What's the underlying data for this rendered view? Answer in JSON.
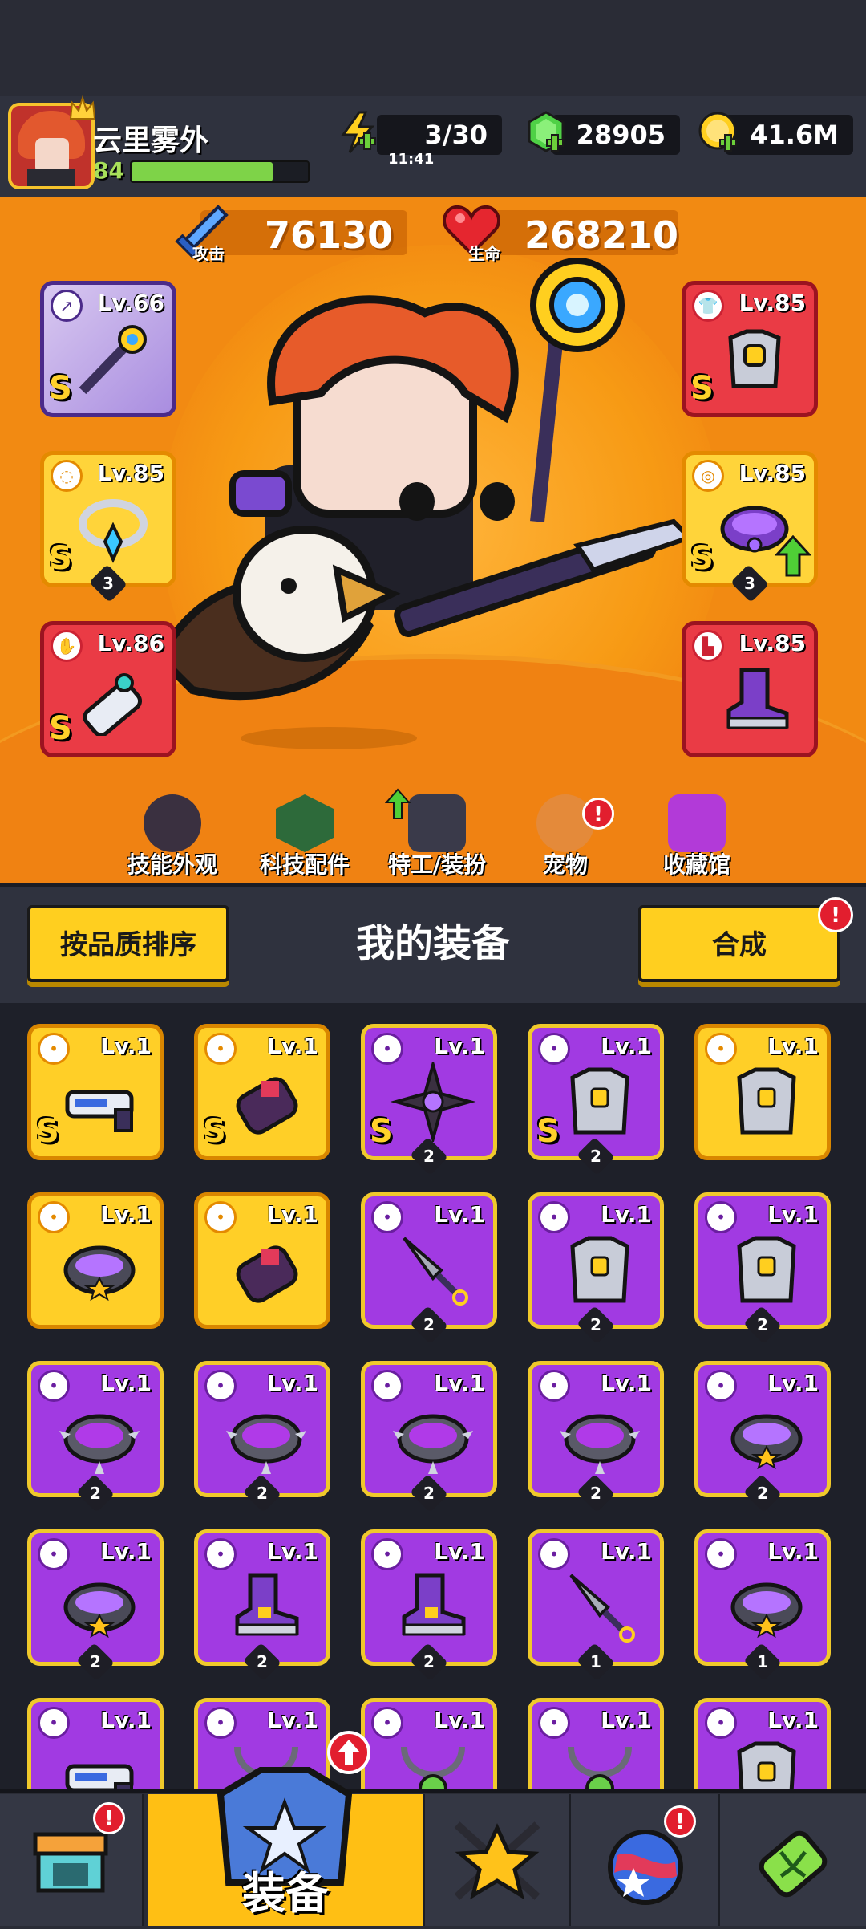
{
  "player": {
    "name": "云里雾外",
    "level": "84",
    "xp_fraction": 0.8
  },
  "resources": {
    "energy": {
      "value": "3/30",
      "timer": "11:41"
    },
    "gems": {
      "value": "28905"
    },
    "coins": {
      "value": "41.6M"
    }
  },
  "stats": {
    "attack": {
      "label": "攻击",
      "value": "76130"
    },
    "health": {
      "label": "生命",
      "value": "268210"
    }
  },
  "equipped": {
    "weapon": {
      "level": "Lv.66",
      "grade": "S"
    },
    "necklace": {
      "level": "Lv.85",
      "grade": "S",
      "count": "3"
    },
    "glove": {
      "level": "Lv.86",
      "grade": "S"
    },
    "armor": {
      "level": "Lv.85",
      "grade": "S"
    },
    "belt": {
      "level": "Lv.85",
      "grade": "S",
      "count": "3"
    },
    "boots": {
      "level": "Lv.85"
    }
  },
  "hero_nav": [
    {
      "label": "技能外观"
    },
    {
      "label": "科技配件"
    },
    {
      "label": "特工/装扮"
    },
    {
      "label": "宠物"
    },
    {
      "label": "收藏馆"
    }
  ],
  "equipment_panel": {
    "title": "我的装备",
    "sort_label": "按品质排序",
    "merge_label": "合成"
  },
  "inventory": [
    {
      "level": "Lv.1",
      "grade": "S",
      "quality": "gold",
      "icon": "gun-icon"
    },
    {
      "level": "Lv.1",
      "grade": "S",
      "quality": "gold",
      "icon": "glove-icon"
    },
    {
      "level": "Lv.1",
      "grade": "S",
      "quality": "purple",
      "icon": "shuriken-icon",
      "count": "2"
    },
    {
      "level": "Lv.1",
      "grade": "S",
      "quality": "purple",
      "icon": "armor-icon",
      "count": "2"
    },
    {
      "level": "Lv.1",
      "quality": "gold",
      "icon": "armor-icon"
    },
    {
      "level": "Lv.1",
      "quality": "gold",
      "icon": "belt-icon"
    },
    {
      "level": "Lv.1",
      "quality": "gold",
      "icon": "glove-icon"
    },
    {
      "level": "Lv.1",
      "quality": "purple",
      "icon": "kunai-icon",
      "count": "2"
    },
    {
      "level": "Lv.1",
      "quality": "purple",
      "icon": "armor-icon",
      "count": "2"
    },
    {
      "level": "Lv.1",
      "quality": "purple",
      "icon": "armor-icon",
      "count": "2"
    },
    {
      "level": "Lv.1",
      "quality": "purple",
      "icon": "spiked-collar-icon",
      "count": "2"
    },
    {
      "level": "Lv.1",
      "quality": "purple",
      "icon": "spiked-collar-icon",
      "count": "2"
    },
    {
      "level": "Lv.1",
      "quality": "purple",
      "icon": "spiked-collar-icon",
      "count": "2"
    },
    {
      "level": "Lv.1",
      "quality": "purple",
      "icon": "spiked-collar-icon",
      "count": "2"
    },
    {
      "level": "Lv.1",
      "quality": "purple",
      "icon": "belt-icon",
      "count": "2"
    },
    {
      "level": "Lv.1",
      "quality": "purple",
      "icon": "belt-icon",
      "count": "2"
    },
    {
      "level": "Lv.1",
      "quality": "purple",
      "icon": "boot-icon",
      "count": "2"
    },
    {
      "level": "Lv.1",
      "quality": "purple",
      "icon": "boot-icon",
      "count": "2"
    },
    {
      "level": "Lv.1",
      "quality": "purple",
      "icon": "kunai-icon",
      "count": "1"
    },
    {
      "level": "Lv.1",
      "quality": "purple",
      "icon": "belt-icon",
      "count": "1"
    },
    {
      "level": "Lv.1",
      "quality": "purple",
      "icon": "gun-icon"
    },
    {
      "level": "Lv.1",
      "quality": "purple",
      "icon": "necklace-icon"
    },
    {
      "level": "Lv.1",
      "quality": "purple",
      "icon": "necklace-icon"
    },
    {
      "level": "Lv.1",
      "quality": "purple",
      "icon": "necklace-icon"
    },
    {
      "level": "Lv.1",
      "quality": "purple",
      "icon": "armor-icon"
    }
  ],
  "bottom_nav": [
    {
      "label": "",
      "icon": "shop-icon"
    },
    {
      "label": "装备",
      "icon": "equipment-icon",
      "active": true
    },
    {
      "label": "",
      "icon": "star-swords-icon"
    },
    {
      "label": "",
      "icon": "planet-icon"
    },
    {
      "label": "",
      "icon": "dna-icon"
    }
  ],
  "colors": {
    "hero_bg": "#f28a12",
    "gold_card": "#ffcf27",
    "purple_card": "#a13ae2",
    "accent_yellow": "#ffcf1f"
  }
}
